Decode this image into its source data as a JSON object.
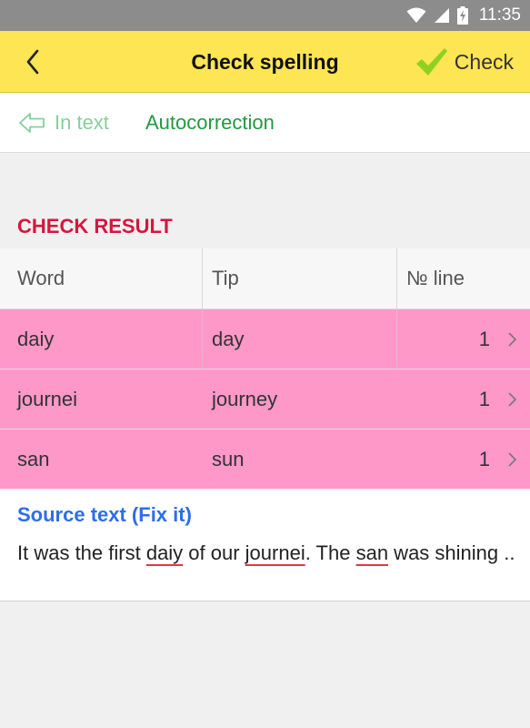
{
  "status_bar": {
    "time": "11:35",
    "icons": [
      "wifi-icon",
      "cell-signal-icon",
      "battery-charging-icon"
    ]
  },
  "toolbar": {
    "title": "Check spelling",
    "check_label": "Check",
    "back_icon": "chevron-left-icon",
    "check_icon": "checkmark-icon"
  },
  "tabs": {
    "in_text": "In text",
    "autocorrection": "Autocorrection"
  },
  "check_result": {
    "title": "CHECK RESULT",
    "columns": {
      "word": "Word",
      "tip": "Tip",
      "line": "№ line"
    },
    "rows": [
      {
        "word": "daiy",
        "tip": "day",
        "line": "1"
      },
      {
        "word": "journei",
        "tip": "journey",
        "line": "1"
      },
      {
        "word": "san",
        "tip": "sun",
        "line": "1"
      }
    ]
  },
  "source": {
    "title": "Source text (Fix it)",
    "text_parts": [
      "It was the first ",
      "daiy",
      " of our ",
      "journei",
      ". The ",
      "san",
      " was shining .."
    ]
  },
  "colors": {
    "toolbar": "#fde553",
    "row_highlight": "#fd98c9",
    "section_title": "#d6163e",
    "source_title": "#2d6ee8",
    "tab_active": "#1f9a40",
    "tab_inactive": "#86cf9c"
  }
}
